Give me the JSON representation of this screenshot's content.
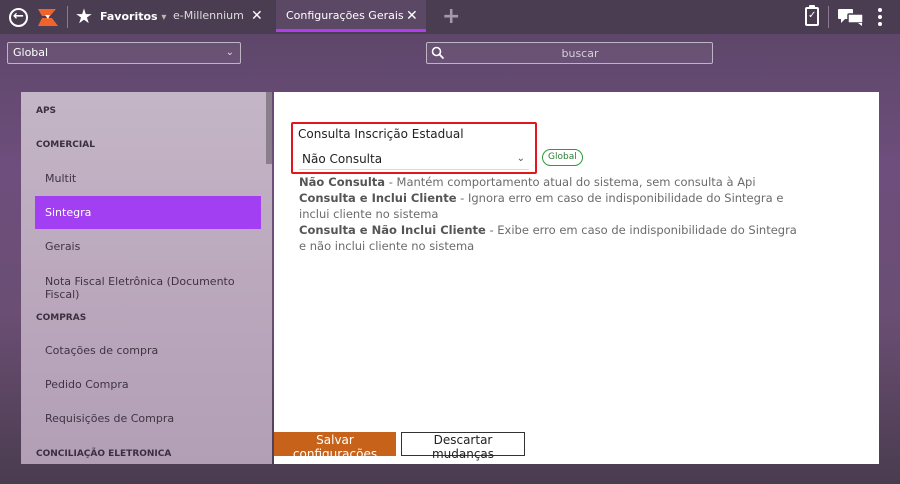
{
  "topbar": {
    "favorites_label": "Favoritos",
    "favorites_arrow": "▾",
    "tabs": [
      {
        "label": "e-Millennium",
        "close": "✕"
      },
      {
        "label": "Configurações Gerais",
        "close": "✕"
      }
    ],
    "add_tab_icon": "+",
    "icons": [
      "back-icon",
      "logo",
      "star-icon",
      "clipboard-check-icon",
      "chat-icon",
      "kebab-menu-icon"
    ]
  },
  "filters": {
    "scope_value": "Global",
    "search_placeholder": "buscar"
  },
  "sidebar": {
    "groups": [
      {
        "label": "APS"
      },
      {
        "label": "COMERCIAL",
        "items": [
          "Multit",
          "Sintegra",
          "Gerais",
          "Nota Fiscal Eletrônica (Documento Fiscal)"
        ]
      },
      {
        "label": "COMPRAS",
        "items": [
          "Cotações de compra",
          "Pedido Compra",
          "Requisições de Compra"
        ]
      },
      {
        "label": "CONCILIAÇÃO ELETRONICA"
      }
    ],
    "active_item": "Sintegra"
  },
  "setting": {
    "label": "Consulta Inscrição Estadual",
    "selected_value": "Não Consulta",
    "badge": "Global",
    "options_help": [
      {
        "name": "Não Consulta",
        "description": " - Mantém comportamento atual do sistema, sem consulta à Api"
      },
      {
        "name": "Consulta e Inclui Cliente",
        "description": " - Ignora erro em caso de indisponibilidade do Sintegra e inclui cliente no sistema"
      },
      {
        "name": "Consulta e Não Inclui Cliente",
        "description": " - Exibe erro em caso de indisponibilidade do Sintegra e não inclui cliente no sistema"
      }
    ]
  },
  "actions": {
    "save_label": "Salvar configurações",
    "discard_label": "Descartar mudanças"
  },
  "colors": {
    "accent": "#a33ff2",
    "save_button": "#c7621b",
    "highlight_border": "#e3161c",
    "badge": "#2f9a3a"
  }
}
